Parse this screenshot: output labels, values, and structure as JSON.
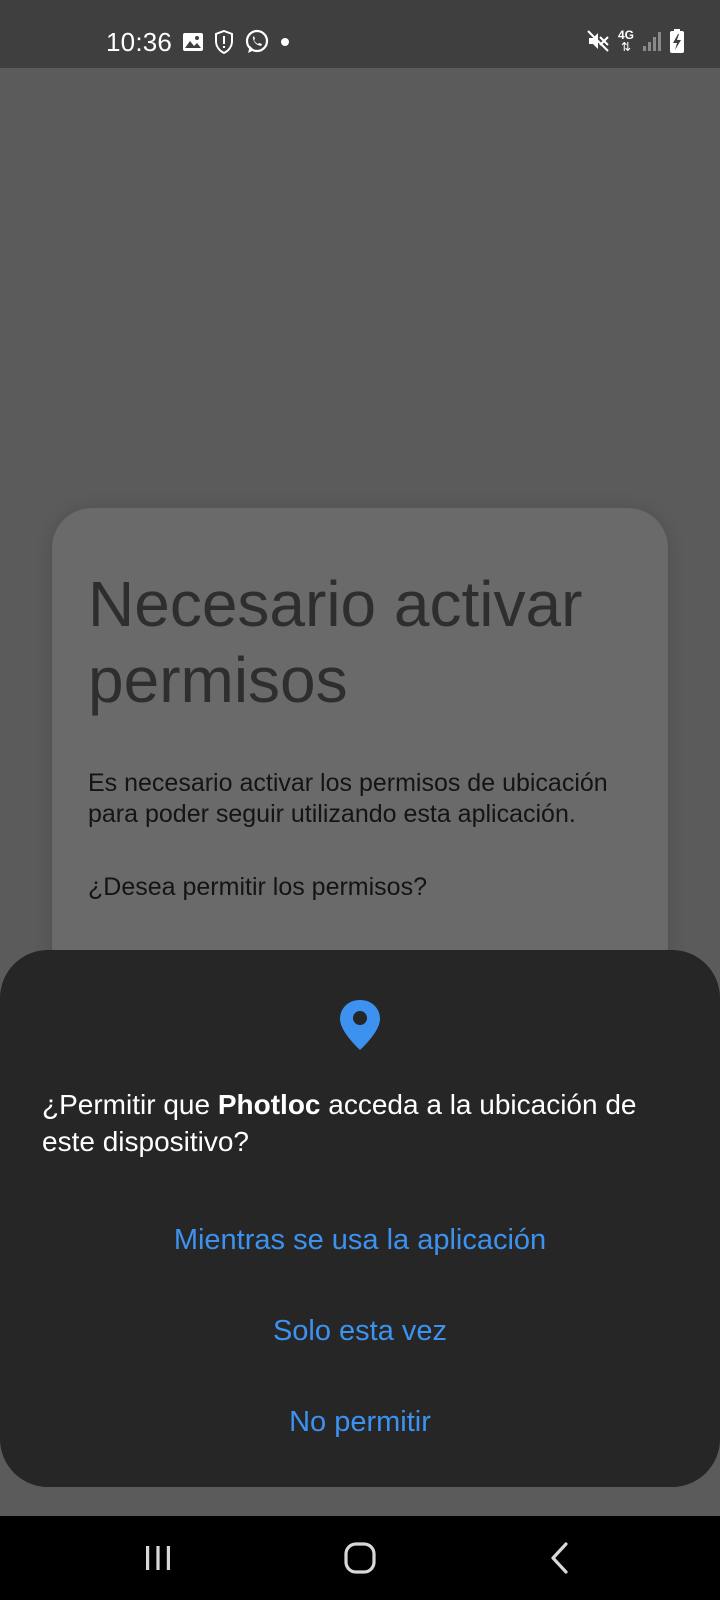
{
  "status_bar": {
    "time": "10:36",
    "network": "4G",
    "left_icons": [
      "gallery-icon",
      "shield-alert-icon",
      "whatsapp-icon",
      "notification-dot-icon"
    ],
    "right_icons": [
      "mute-icon",
      "network-4g-icon",
      "signal-icon",
      "battery-charging-icon"
    ]
  },
  "app_card": {
    "title": "Necesario activar permisos",
    "body": "Es necesario activar los permisos de ubicación para poder seguir utilizando esta aplicación.",
    "question": "¿Desea permitir los permisos?"
  },
  "permission_dialog": {
    "icon": "location-pin-icon",
    "question_prefix": "¿Permitir que ",
    "app_name": "Photloc",
    "question_suffix": " acceda a la ubicación de este dispositivo?",
    "options": [
      "Mientras se usa la aplicación",
      "Solo esta vez",
      "No permitir"
    ],
    "accent_color": "#3d92f0"
  },
  "nav_bar": {
    "buttons": [
      "recents-icon",
      "home-icon",
      "back-icon"
    ]
  }
}
